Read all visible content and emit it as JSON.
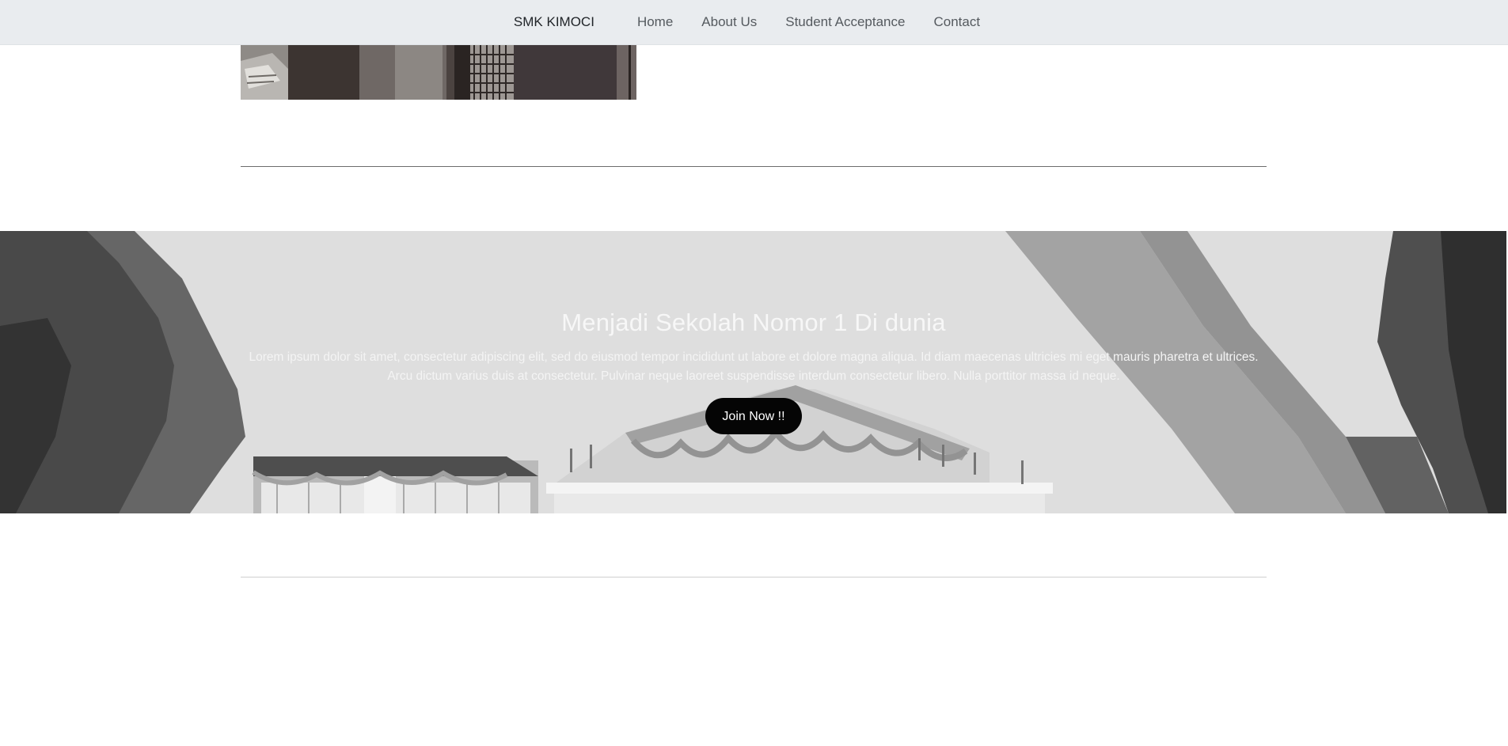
{
  "navbar": {
    "brand": "SMK KIMOCI",
    "links": [
      "Home",
      "About Us",
      "Student Acceptance",
      "Contact"
    ]
  },
  "hero": {
    "title": "Menjadi Sekolah Nomor 1 Di dunia",
    "text": "Lorem ipsum dolor sit amet, consectetur adipiscing elit, sed do eiusmod tempor incididunt ut labore et dolore magna aliqua. Id diam maecenas ultricies mi eget mauris pharetra et ultrices. Arcu dictum varius duis at consectetur. Pulvinar neque laoreet suspendisse interdum consectetur libero. Nulla porttitor massa id neque.",
    "button_label": "Join Now !!"
  },
  "colors": {
    "navbar_bg": "#e9ecef",
    "button_bg": "#050505",
    "hero_overlay": "#d9d9d9"
  }
}
